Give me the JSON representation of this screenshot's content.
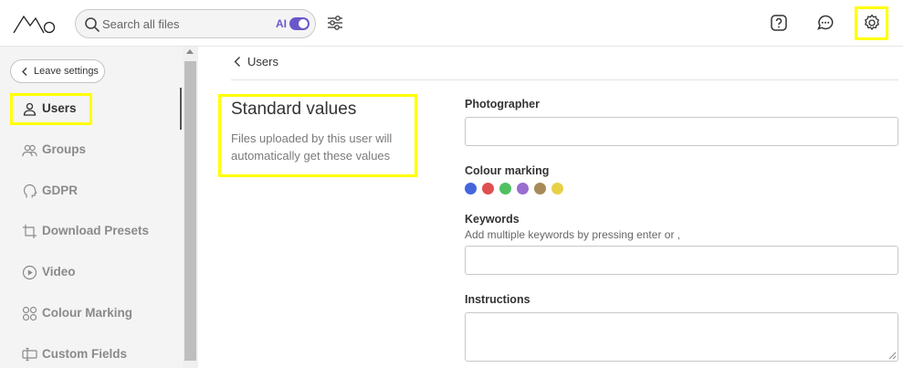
{
  "search": {
    "placeholder": "Search all files",
    "ai_label": "AI",
    "ai_enabled": true
  },
  "header_icons": [
    "help-icon",
    "chat-icon",
    "settings-icon"
  ],
  "sidebar": {
    "leave_label": "Leave settings",
    "items": [
      {
        "label": "Users",
        "icon": "user-icon",
        "active": true
      },
      {
        "label": "Groups",
        "icon": "groups-icon",
        "active": false
      },
      {
        "label": "GDPR",
        "icon": "gdpr-head-icon",
        "active": false
      },
      {
        "label": "Download Presets",
        "icon": "crop-icon",
        "active": false
      },
      {
        "label": "Video",
        "icon": "play-icon",
        "active": false
      },
      {
        "label": "Colour Marking",
        "icon": "colour-marking-icon",
        "active": false
      },
      {
        "label": "Custom Fields",
        "icon": "custom-fields-icon",
        "active": false
      }
    ]
  },
  "breadcrumb": {
    "label": "Users"
  },
  "section": {
    "title": "Standard values",
    "description": "Files uploaded by this user will automatically get these values"
  },
  "fields": {
    "photographer": {
      "label": "Photographer",
      "value": ""
    },
    "colour_marking": {
      "label": "Colour marking",
      "colors": [
        "#4466dd",
        "#e05050",
        "#50c060",
        "#9a6ccf",
        "#a88a58",
        "#e8d046"
      ]
    },
    "keywords": {
      "label": "Keywords",
      "hint": "Add multiple keywords by pressing enter or ,",
      "value": ""
    },
    "instructions": {
      "label": "Instructions",
      "value": ""
    }
  },
  "colors": {
    "accent": "#6a58c9",
    "highlight": "#ffff00",
    "sidebar_bg": "#f4f4f5"
  }
}
